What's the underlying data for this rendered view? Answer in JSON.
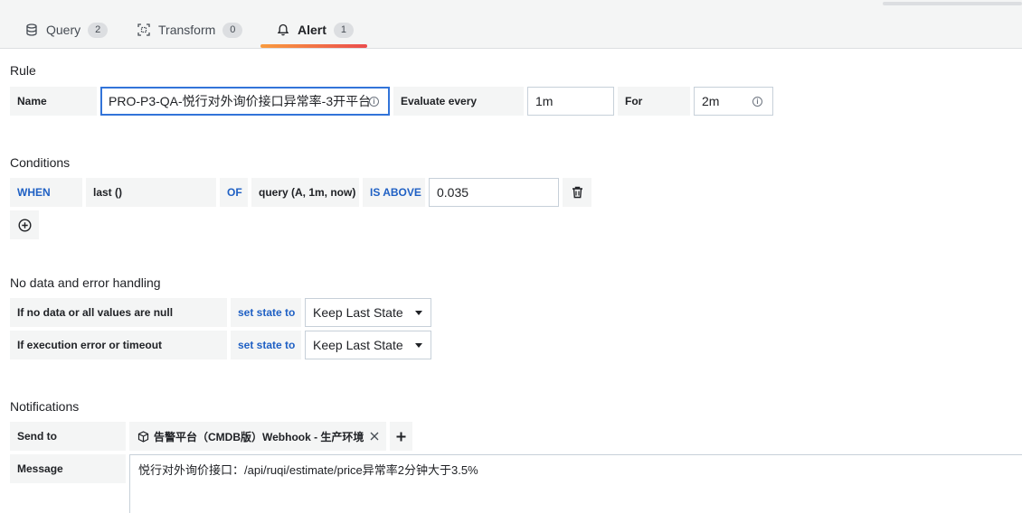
{
  "tabs": [
    {
      "label": "Query",
      "count": "2",
      "icon": "database-icon"
    },
    {
      "label": "Transform",
      "count": "0",
      "icon": "transform-icon"
    },
    {
      "label": "Alert",
      "count": "1",
      "icon": "bell-icon",
      "active": true
    }
  ],
  "rule": {
    "title": "Rule",
    "name_label": "Name",
    "name_value": "PRO-P3-QA-悦行对外询价接口异常率-3开平台",
    "evaluate_label": "Evaluate every",
    "evaluate_value": "1m",
    "for_label": "For",
    "for_value": "2m"
  },
  "conditions": {
    "title": "Conditions",
    "when": "WHEN",
    "reducer": "last ()",
    "of": "OF",
    "query": "query (A, 1m, now)",
    "evaluator": "IS ABOVE",
    "threshold": "0.035"
  },
  "nodata": {
    "title": "No data and error handling",
    "rows": [
      {
        "label": "If no data or all values are null",
        "set_label": "set state to",
        "state": "Keep Last State"
      },
      {
        "label": "If execution error or timeout",
        "set_label": "set state to",
        "state": "Keep Last State"
      }
    ]
  },
  "notifications": {
    "title": "Notifications",
    "send_to_label": "Send to",
    "channel": "告警平台（CMDB版）Webhook - 生产环境",
    "message_label": "Message",
    "message": "悦行对外询价接口：/api/ruqi/estimate/price异常率2分钟大于3.5%"
  },
  "colors": {
    "accent_blue": "#1f60c4",
    "focus_blue": "#3274d9",
    "tab_gradient_start": "#f99b3e",
    "tab_gradient_end": "#eb4d4d"
  }
}
